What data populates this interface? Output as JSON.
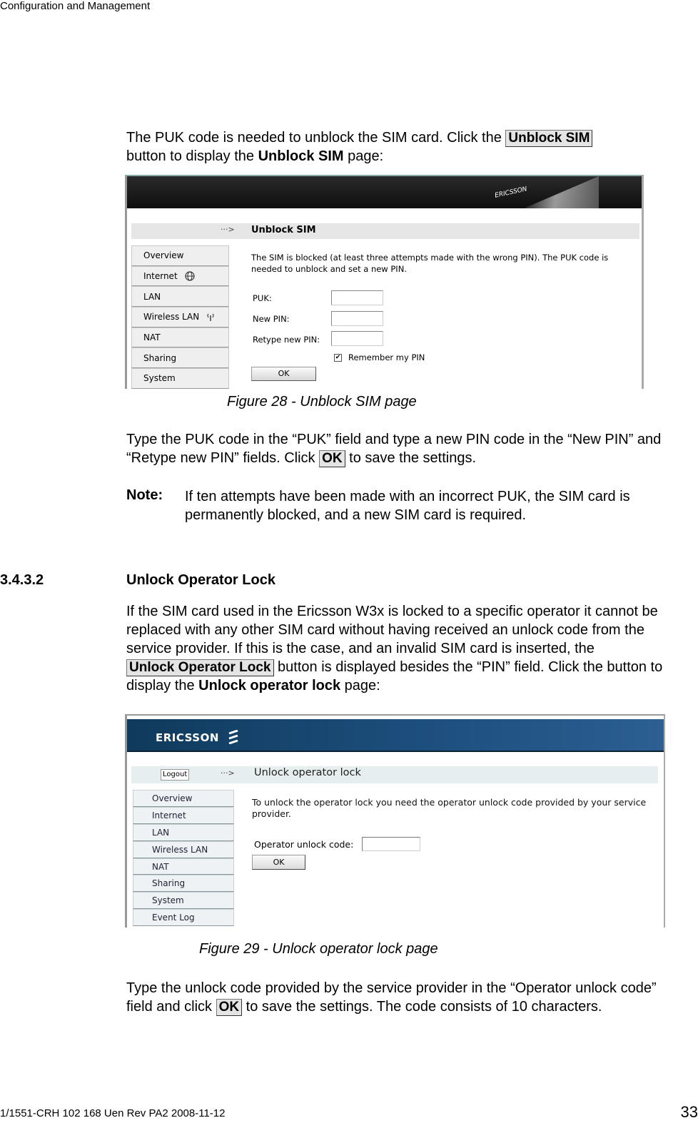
{
  "running_header": "Configuration and Management",
  "intro": {
    "before_button": "The PUK code is needed to unblock the SIM card. Click the ",
    "button_label": "Unblock SIM",
    "line2_before": "button to display the ",
    "line2_bold": "Unblock SIM",
    "line2_after": " page:"
  },
  "figure28": {
    "caption": "Figure 28 - Unblock SIM page",
    "banner_logo": "ERICSSON",
    "page_arrow": "···>",
    "page_title": "Unblock SIM",
    "nav": [
      {
        "label": "Overview",
        "icon": ""
      },
      {
        "label": "Internet",
        "icon": "globe-icon"
      },
      {
        "label": "LAN",
        "icon": ""
      },
      {
        "label": "Wireless LAN",
        "icon": "wireless-icon"
      },
      {
        "label": "NAT",
        "icon": ""
      },
      {
        "label": "Sharing",
        "icon": ""
      },
      {
        "label": "System",
        "icon": ""
      }
    ],
    "description": "The SIM is blocked (at least three attempts made with the wrong PIN). The PUK code is needed to unblock and set a new PIN.",
    "fields": [
      {
        "label": "PUK:",
        "value": ""
      },
      {
        "label": "New PIN:",
        "value": ""
      },
      {
        "label": "Retype new PIN:",
        "value": ""
      }
    ],
    "remember_label": "Remember my PIN",
    "remember_checked": true,
    "ok_label": "OK"
  },
  "para_type_puk": {
    "text_before": "Type the PUK code in the “PUK” field and type a new PIN code in the “New PIN” and “Retype new PIN” fields. Click ",
    "button_label": "OK",
    "text_after": " to save the settings."
  },
  "note": {
    "label": "Note:",
    "text": "If ten attempts have been made with an incorrect PUK, the SIM card is permanently blocked, and a new SIM card is required."
  },
  "section": {
    "number": "3.4.3.2",
    "title": "Unlock Operator Lock"
  },
  "para_operator": {
    "text_before": "If the SIM card used in the Ericsson W3x is locked to a specific operator it cannot be replaced with any other SIM card without having received an unlock code from the service provider. If this is the case, and an invalid SIM card is inserted, the ",
    "button_label": "Unlock Operator Lock ",
    "text_middle": " button is displayed besides the “PIN” field. Click the button to display the ",
    "bold": "Unlock operator lock",
    "text_after": " page:"
  },
  "figure29": {
    "caption": "Figure 29 - Unlock operator lock page",
    "banner_logo": "ERICSSON",
    "logout_label": "Logout",
    "page_arrow": "···>",
    "page_title": "Unlock operator lock",
    "nav": [
      "Overview",
      "Internet",
      "LAN",
      "Wireless LAN",
      "NAT",
      "Sharing",
      "System",
      "Event Log"
    ],
    "description": "To unlock the operator lock you need the operator unlock code provided by your service provider.",
    "field_label": "Operator unlock code:",
    "field_value": "",
    "ok_label": "OK"
  },
  "para_unlock_code": {
    "text_before": "Type the unlock code provided by the service provider in the “Operator unlock code” field and click ",
    "button_label": "OK",
    "text_after": " to save the settings. The code consists of 10 characters."
  },
  "footer": {
    "doc_id": "1/1551-CRH 102 168 Uen Rev PA2  2008-11-12",
    "page_number": "33"
  }
}
